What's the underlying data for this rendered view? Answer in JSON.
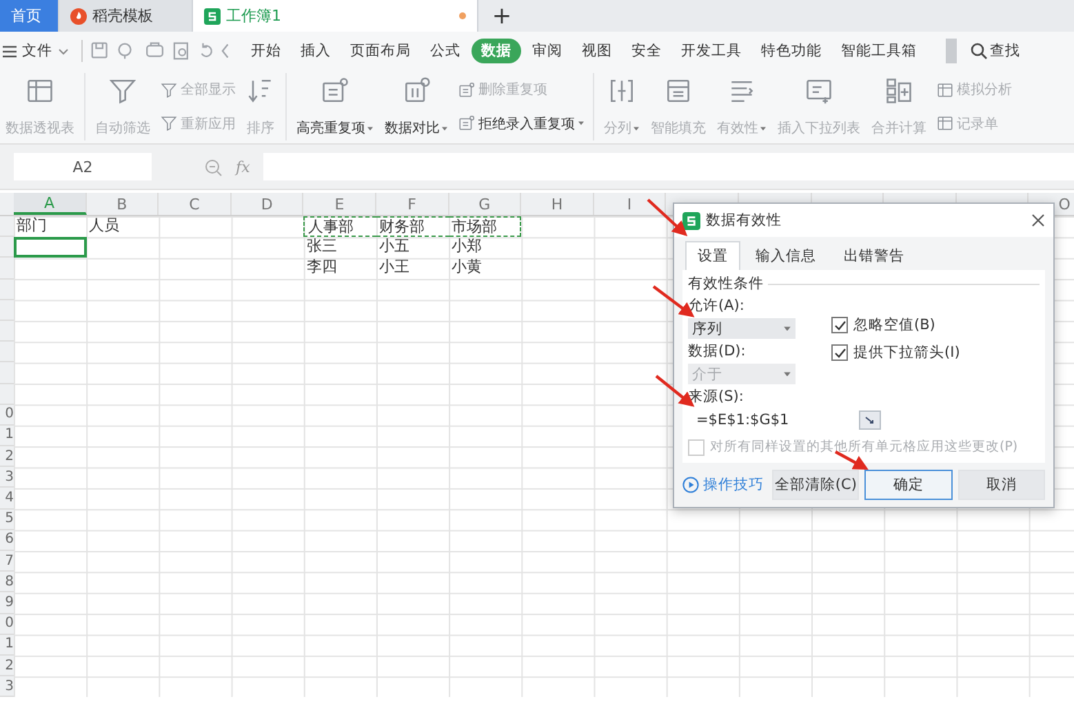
{
  "tabs": [
    {
      "label": "首页",
      "selected": false,
      "kind": "home",
      "unsaved": false
    },
    {
      "label": "稻壳模板",
      "selected": false,
      "kind": "docer",
      "unsaved": false
    },
    {
      "label": "工作簿1",
      "selected": true,
      "kind": "sheet",
      "unsaved": true
    }
  ],
  "new_tab": "+",
  "menu": {
    "file": "文件",
    "items": [
      {
        "label": "开始",
        "selected": false
      },
      {
        "label": "插入",
        "selected": false
      },
      {
        "label": "页面布局",
        "selected": false
      },
      {
        "label": "公式",
        "selected": false
      },
      {
        "label": "数据",
        "selected": true
      },
      {
        "label": "审阅",
        "selected": false
      },
      {
        "label": "视图",
        "selected": false
      },
      {
        "label": "安全",
        "selected": false
      },
      {
        "label": "开发工具",
        "selected": false
      },
      {
        "label": "特色功能",
        "selected": false
      },
      {
        "label": "智能工具箱",
        "selected": false
      }
    ],
    "search": "查找"
  },
  "ribbon": [
    {
      "kind": "big",
      "label": "数据透视表",
      "disabled": true,
      "dropdown": false
    },
    {
      "kind": "big",
      "label": "自动筛选",
      "disabled": true,
      "dropdown": false
    },
    {
      "kind": "stack",
      "items": [
        {
          "label": "全部显示",
          "disabled": true,
          "dropdown": false
        },
        {
          "label": "重新应用",
          "disabled": true,
          "dropdown": false
        }
      ]
    },
    {
      "kind": "big",
      "label": "排序",
      "disabled": true,
      "dropdown": false
    },
    {
      "kind": "big",
      "label": "高亮重复项",
      "disabled": false,
      "dropdown": true
    },
    {
      "kind": "big",
      "label": "数据对比",
      "disabled": false,
      "dropdown": true
    },
    {
      "kind": "stack",
      "items": [
        {
          "label": "删除重复项",
          "disabled": true,
          "dropdown": false
        },
        {
          "label": "拒绝录入重复项",
          "disabled": false,
          "dropdown": true
        }
      ]
    },
    {
      "kind": "big",
      "label": "分列",
      "disabled": true,
      "dropdown": true
    },
    {
      "kind": "big",
      "label": "智能填充",
      "disabled": true,
      "dropdown": false
    },
    {
      "kind": "big",
      "label": "有效性",
      "disabled": true,
      "dropdown": true
    },
    {
      "kind": "big",
      "label": "插入下拉列表",
      "disabled": true,
      "dropdown": false
    },
    {
      "kind": "big",
      "label": "合并计算",
      "disabled": true,
      "dropdown": false
    },
    {
      "kind": "stack",
      "items": [
        {
          "label": "模拟分析",
          "disabled": true,
          "dropdown": false
        },
        {
          "label": "记录单",
          "disabled": true,
          "dropdown": false
        }
      ]
    }
  ],
  "formula_bar": {
    "name_box": "A2",
    "fx": "fx"
  },
  "sheet": {
    "columns": [
      "A",
      "B",
      "C",
      "D",
      "E",
      "F",
      "G",
      "H",
      "I",
      "O"
    ],
    "row_headers": [
      "0",
      "1",
      "2",
      "3",
      "4",
      "5",
      "6",
      "7",
      "8",
      "9",
      "0",
      "1",
      "2",
      "3"
    ],
    "rows": [
      [
        {
          "text": "部门",
          "selected": false,
          "copied": false
        },
        {
          "text": "人员",
          "selected": false,
          "copied": false
        },
        {
          "selected": false,
          "copied": false
        },
        {
          "selected": false,
          "copied": false
        },
        {
          "text": "人事部",
          "selected": false,
          "copied": true
        },
        {
          "text": "财务部",
          "selected": false,
          "copied": true
        },
        {
          "text": "市场部",
          "selected": false,
          "copied": true
        }
      ],
      [
        {
          "selected": true,
          "copied": false
        },
        {
          "selected": false,
          "copied": false
        },
        {
          "selected": false,
          "copied": false
        },
        {
          "selected": false,
          "copied": false
        },
        {
          "text": "张三",
          "selected": false,
          "copied": false
        },
        {
          "text": "小五",
          "selected": false,
          "copied": false
        },
        {
          "text": "小郑",
          "selected": false,
          "copied": false
        }
      ],
      [
        {
          "selected": false,
          "copied": false
        },
        {
          "selected": false,
          "copied": false
        },
        {
          "selected": false,
          "copied": false
        },
        {
          "selected": false,
          "copied": false
        },
        {
          "text": "李四",
          "selected": false,
          "copied": false
        },
        {
          "text": "小王",
          "selected": false,
          "copied": false
        },
        {
          "text": "小黄",
          "selected": false,
          "copied": false
        }
      ]
    ]
  },
  "dialog": {
    "title": "数据有效性",
    "tabs": [
      {
        "label": "设置",
        "selected": true
      },
      {
        "label": "输入信息",
        "selected": false
      },
      {
        "label": "出错警告",
        "selected": false
      }
    ],
    "group": "有效性条件",
    "allow": {
      "label": "允许(A):",
      "value": "序列",
      "disabled": false
    },
    "data": {
      "label": "数据(D):",
      "value": "介于",
      "disabled": true
    },
    "checks": [
      {
        "label": "忽略空值(B)",
        "checked": true
      },
      {
        "label": "提供下拉箭头(I)",
        "checked": true
      }
    ],
    "source": {
      "label": "来源(S):",
      "value": "=$E$1:$G$1"
    },
    "apply_all": {
      "label": "对所有同样设置的其他所有单元格应用这些更改(P)",
      "checked": false,
      "disabled": true
    },
    "tips": "操作技巧",
    "buttons": [
      {
        "label": "全部清除(C)",
        "default": false
      },
      {
        "label": "确定",
        "default": true
      },
      {
        "label": "取消",
        "default": false
      }
    ]
  }
}
